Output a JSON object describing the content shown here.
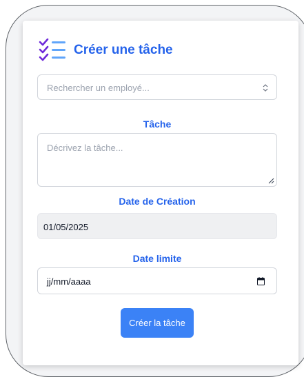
{
  "form": {
    "title": "Créer une tâche",
    "title_icon": "checklist-icon",
    "employee_select": {
      "placeholder": "Rechercher un employé...",
      "icon": "select-arrows-icon"
    },
    "task": {
      "label": "Tâche",
      "placeholder": "Décrivez la tâche..."
    },
    "creation_date": {
      "label": "Date de Création",
      "value": "01/05/2025"
    },
    "deadline": {
      "label": "Date limite",
      "placeholder": "jj/mm/aaaa",
      "icon": "calendar-icon"
    },
    "submit_label": "Créer la tâche"
  },
  "colors": {
    "accent": "#2563eb",
    "button": "#3b82f6",
    "frame_border": "#5f6368",
    "placeholder_text": "#9ca3af"
  }
}
